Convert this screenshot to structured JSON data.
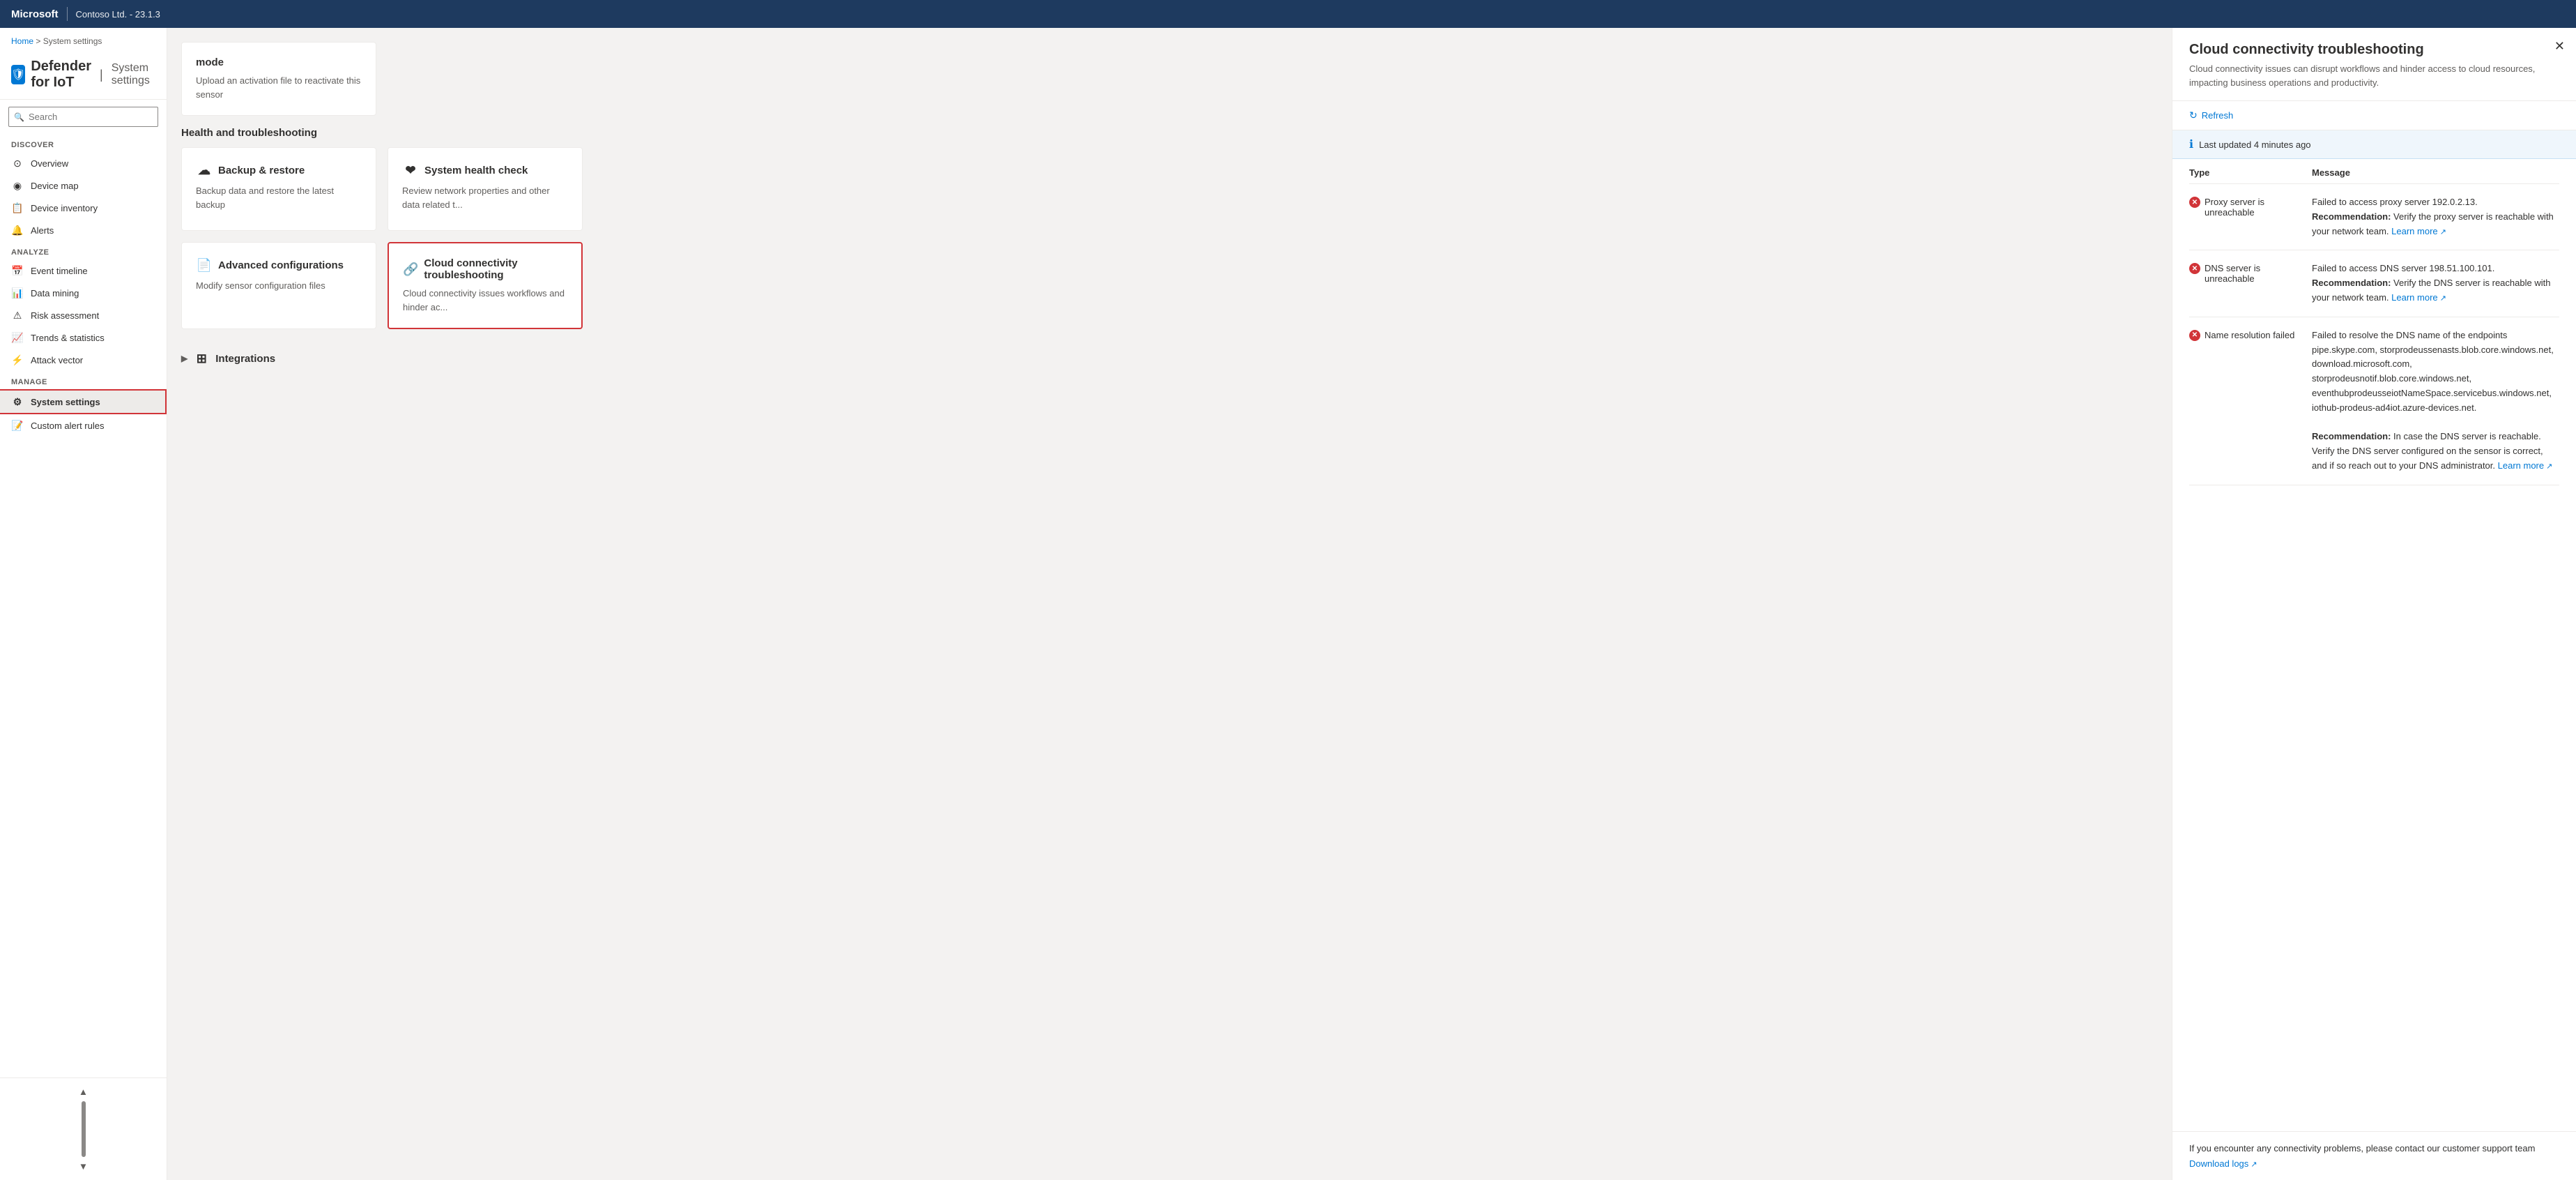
{
  "topbar": {
    "brand": "Microsoft",
    "org": "Contoso Ltd. - 23.1.3"
  },
  "breadcrumb": {
    "home": "Home",
    "separator": ">",
    "current": "System settings"
  },
  "page_title": {
    "icon": "🛡",
    "title": "Defender for IoT",
    "separator": "|",
    "subtitle": "System settings"
  },
  "search": {
    "placeholder": "Search"
  },
  "sidebar": {
    "sections": [
      {
        "label": "Discover",
        "items": [
          {
            "id": "overview",
            "label": "Overview",
            "icon": "⊙"
          },
          {
            "id": "device-map",
            "label": "Device map",
            "icon": "◉"
          },
          {
            "id": "device-inventory",
            "label": "Device inventory",
            "icon": "📋"
          },
          {
            "id": "alerts",
            "label": "Alerts",
            "icon": "🔔"
          }
        ]
      },
      {
        "label": "Analyze",
        "items": [
          {
            "id": "event-timeline",
            "label": "Event timeline",
            "icon": "📅"
          },
          {
            "id": "data-mining",
            "label": "Data mining",
            "icon": "📊"
          },
          {
            "id": "risk-assessment",
            "label": "Risk assessment",
            "icon": "⚠"
          },
          {
            "id": "trends-statistics",
            "label": "Trends & statistics",
            "icon": "📈"
          },
          {
            "id": "attack-vector",
            "label": "Attack vector",
            "icon": "⚡"
          }
        ]
      },
      {
        "label": "Manage",
        "items": [
          {
            "id": "system-settings",
            "label": "System settings",
            "icon": "⚙",
            "active": true
          },
          {
            "id": "custom-alert-rules",
            "label": "Custom alert rules",
            "icon": "📝"
          }
        ]
      }
    ]
  },
  "main_content": {
    "mode_card": {
      "title": "mode",
      "description": "Upload an activation file to reactivate this sensor"
    },
    "health_section": {
      "label": "Health and troubleshooting",
      "cards": [
        {
          "id": "backup-restore",
          "icon": "☁",
          "title": "Backup & restore",
          "description": "Backup data and restore the latest backup"
        },
        {
          "id": "system-health",
          "icon": "❤",
          "title": "System health check",
          "description": "Review network properties and other data related t..."
        },
        {
          "id": "advanced-configurations",
          "icon": "📄",
          "title": "Advanced configurations",
          "description": "Modify sensor configuration files"
        },
        {
          "id": "cloud-connectivity",
          "icon": "🔗",
          "title": "Cloud connectivity troubleshooting",
          "description": "Cloud connectivity issues workflows and hinder ac...",
          "selected": true
        }
      ]
    },
    "integrations": {
      "label": "Integrations"
    }
  },
  "right_panel": {
    "title": "Cloud connectivity troubleshooting",
    "subtitle": "Cloud connectivity issues can disrupt workflows and hinder access to cloud resources, impacting business operations and productivity.",
    "refresh_label": "Refresh",
    "info_bar": "Last updated 4 minutes ago",
    "table": {
      "headers": [
        "Type",
        "Message"
      ],
      "rows": [
        {
          "type": "Proxy server is unreachable",
          "message_plain": "Failed to access proxy server 192.0.2.13.",
          "message_bold": "Recommendation:",
          "message_rest": " Verify the proxy server is reachable with your network team.",
          "learn_more": "Learn more"
        },
        {
          "type": "DNS server is unreachable",
          "message_plain": "Failed to access DNS server 198.51.100.101.",
          "message_bold": "Recommendation:",
          "message_rest": " Verify the DNS server is reachable with your network team.",
          "learn_more": "Learn more"
        },
        {
          "type": "Name resolution failed",
          "message_plain": "Failed to resolve the DNS name of the endpoints pipe.skype.com, storprodeussenasts.blob.core.windows.net, download.microsoft.com, storprodeusnotif.blob.core.windows.net, eventhubprodeusseiotNameSpace.servicebus.windows.net, iothub-prodeus-ad4iot.azure-devices.net.",
          "message_bold": "Recommendation:",
          "message_rest": " In case the DNS server is reachable. Verify the DNS server configured on the sensor is correct, and if so reach out to your DNS administrator.",
          "learn_more": "Learn more"
        }
      ]
    },
    "footer": {
      "text": "If you encounter any connectivity problems, please contact our customer support team",
      "download_logs": "Download logs"
    }
  }
}
